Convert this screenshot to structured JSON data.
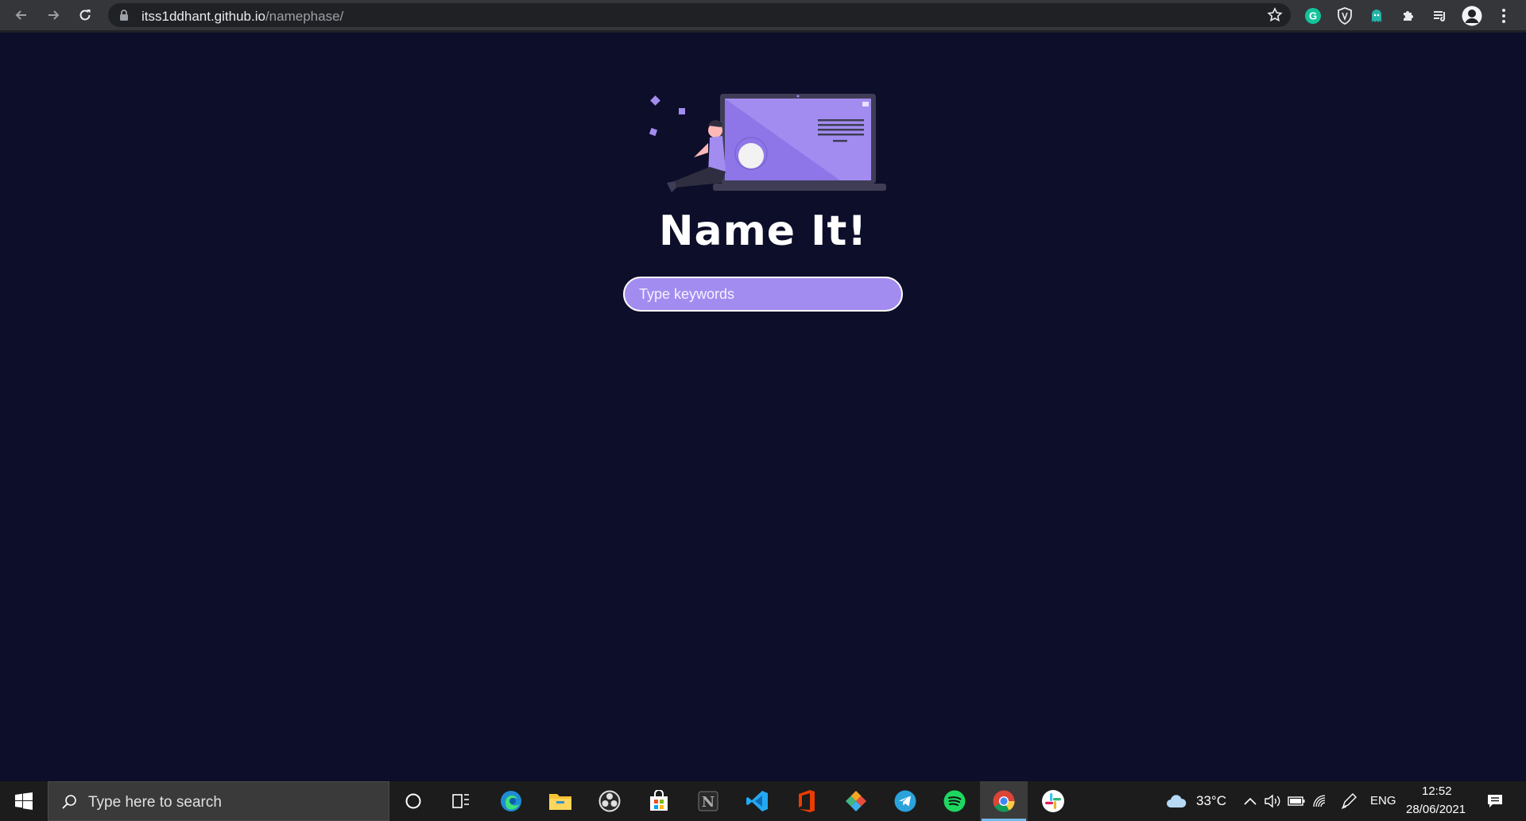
{
  "browser": {
    "url_host": "itss1ddhant.github.io",
    "url_path": "/namephase/"
  },
  "page": {
    "title": "Name It!",
    "search": {
      "placeholder": "Type keywords",
      "value": ""
    },
    "colors": {
      "background": "#0d0f2a",
      "accent": "#a38cf0"
    }
  },
  "taskbar": {
    "search_placeholder": "Type here to search",
    "weather": "33°C",
    "language": "ENG",
    "time": "12:52",
    "date": "28/06/2021",
    "apps": [
      "cortana",
      "task-view",
      "edge",
      "file-explorer",
      "obs",
      "store",
      "notion",
      "vscode",
      "office",
      "git",
      "telegram",
      "spotify",
      "chrome",
      "slack"
    ]
  }
}
